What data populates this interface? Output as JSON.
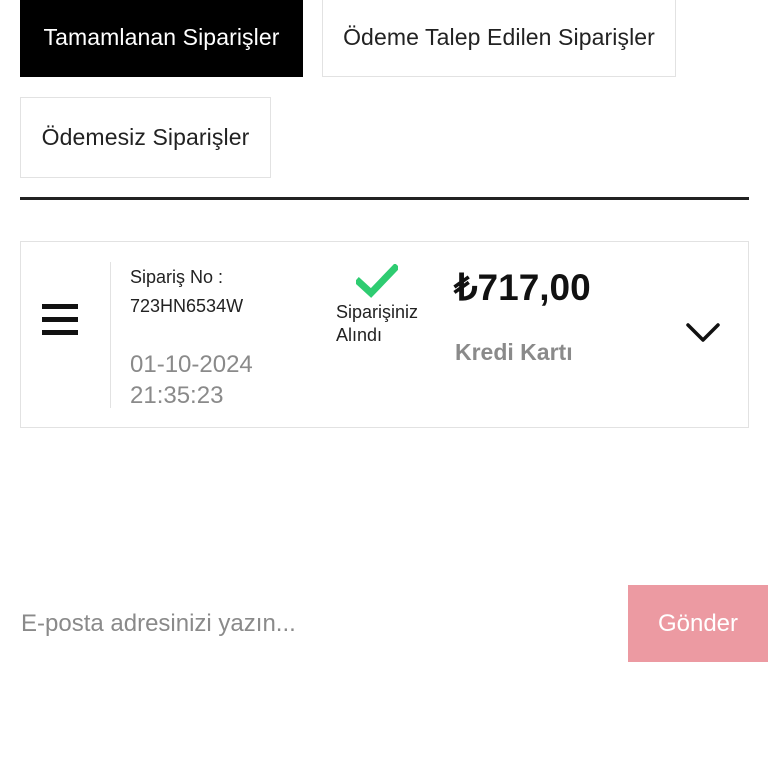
{
  "tabs": {
    "completed": "Tamamlanan Siparişler",
    "payment_requested": "Ödeme Talep Edilen Siparişler",
    "unpaid": "Ödemesiz Siparişler",
    "active": "completed"
  },
  "order": {
    "number_label": "Sipariş No :",
    "number": "723HN6534W",
    "date": "01-10-2024",
    "time": "21:35:23",
    "status_line1": "Siparişiniz",
    "status_line2": "Alındı",
    "price": "₺717,00",
    "payment_method": "Kredi Kartı",
    "icons": {
      "menu": "menu-icon",
      "status": "check-icon",
      "expand": "chevron-down-icon"
    }
  },
  "newsletter": {
    "placeholder": "E-posta adresinizi yazın...",
    "submit_label": "Gönder"
  },
  "colors": {
    "active_tab_bg": "#000000",
    "check_green": "#2ecc71",
    "submit_button_bg": "#ec9aa2",
    "muted_text": "#8a8a8a"
  }
}
